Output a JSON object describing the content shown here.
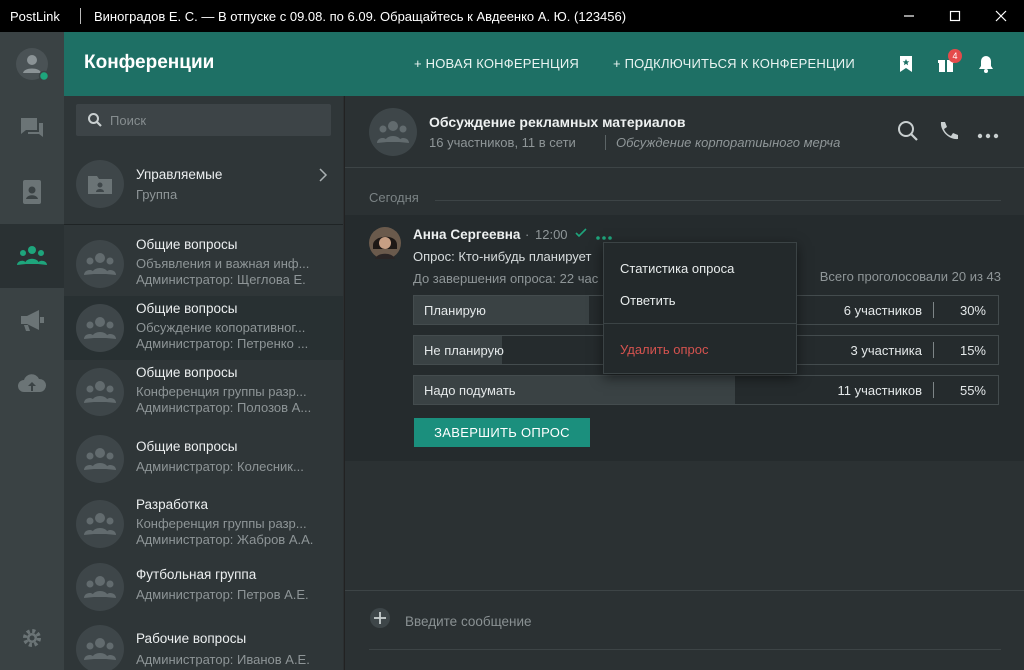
{
  "window": {
    "app_name": "PostLink",
    "title": "Виноградов Е. С. — В отпуске с 09.08. по 6.09. Обращайтесь к Авдеенко А. Ю. (123456)"
  },
  "header": {
    "title": "Конференции",
    "new_conference": "+ НОВАЯ КОНФЕРЕНЦИЯ",
    "join_conference": "+ ПОДКЛЮЧИТЬСЯ К КОНФЕРЕНЦИИ",
    "notification_badge": "4"
  },
  "search": {
    "placeholder": "Поиск"
  },
  "conversations": [
    {
      "name": "Управляемые",
      "line2": "Группа",
      "line3": ""
    },
    {
      "name": "Общие вопросы",
      "line2": "Объявления и важная инф...",
      "line3": "Администратор: Щеглова Е."
    },
    {
      "name": "Общие вопросы",
      "line2": "Обсуждение копоративног...",
      "line3": "Администратор: Петренко ..."
    },
    {
      "name": "Общие вопросы",
      "line2": "Конференция группы разр...",
      "line3": "Администратор: Полозов А..."
    },
    {
      "name": "Общие вопросы",
      "line2": "Администратор: Колесник...",
      "line3": ""
    },
    {
      "name": "Разработка",
      "line2": "Конференция группы разр...",
      "line3": "Администратор: Жабров А.А."
    },
    {
      "name": "Футбольная группа",
      "line2": "Администратор: Петров А.Е.",
      "line3": ""
    },
    {
      "name": "Рабочие вопросы",
      "line2": "Администратор: Иванов А.Е.",
      "line3": ""
    }
  ],
  "chat": {
    "title": "Обсуждение рекламных материалов",
    "subtitle": "16 участников, 11 в сети",
    "description": "Обсуждение корпоратиыного мерча",
    "date_separator": "Сегодня",
    "message": {
      "author": "Анна Сергеевна",
      "time": "12:00",
      "question": "Опрос: Кто-нибудь планирует",
      "remaining": "До завершения опроса: 22 час",
      "total": "Всего проголосовали 20 из 43",
      "options": [
        {
          "label": "Планирую",
          "count": "6 участников",
          "percent": "30%",
          "share": 0.3
        },
        {
          "label": "Не планирую",
          "count": "3 участника",
          "percent": "15%",
          "share": 0.15
        },
        {
          "label": "Надо подумать",
          "count": "11 участников",
          "percent": "55%",
          "share": 0.55
        }
      ],
      "finish_button": "ЗАВЕРШИТЬ ОПРОС"
    },
    "context_menu": {
      "stats": "Статистика опроса",
      "reply": "Ответить",
      "delete": "Удалить опрос"
    },
    "compose_placeholder": "Введите сообщение"
  },
  "colors": {
    "accent": "#1e7065",
    "button": "#1b8f7d",
    "danger": "#d5534f",
    "online": "#1ea57c"
  }
}
